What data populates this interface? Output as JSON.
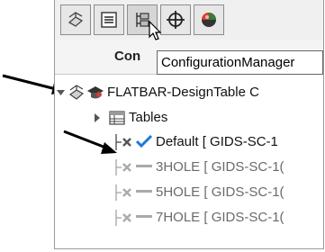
{
  "tabs": [
    {
      "name": "featuremanager-tab"
    },
    {
      "name": "propertymanager-tab"
    },
    {
      "name": "configurationmanager-tab"
    },
    {
      "name": "dimxpertmanager-tab"
    },
    {
      "name": "displaymanager-tab"
    }
  ],
  "header": {
    "column_title": "Con"
  },
  "tooltip": {
    "text": "ConfigurationManager"
  },
  "tree": {
    "root_label": "FLATBAR-DesignTable C",
    "tables_label": "Tables",
    "configs": [
      {
        "label": "Default [ GIDS-SC-1",
        "active": true
      },
      {
        "label": "3HOLE [ GIDS-SC-1(",
        "active": false
      },
      {
        "label": "5HOLE [ GIDS-SC-1(",
        "active": false
      },
      {
        "label": "7HOLE [ GIDS-SC-1(",
        "active": false
      }
    ]
  },
  "colors": {
    "check": "#1c7ad9",
    "inactive_text": "#6a6a6a"
  }
}
